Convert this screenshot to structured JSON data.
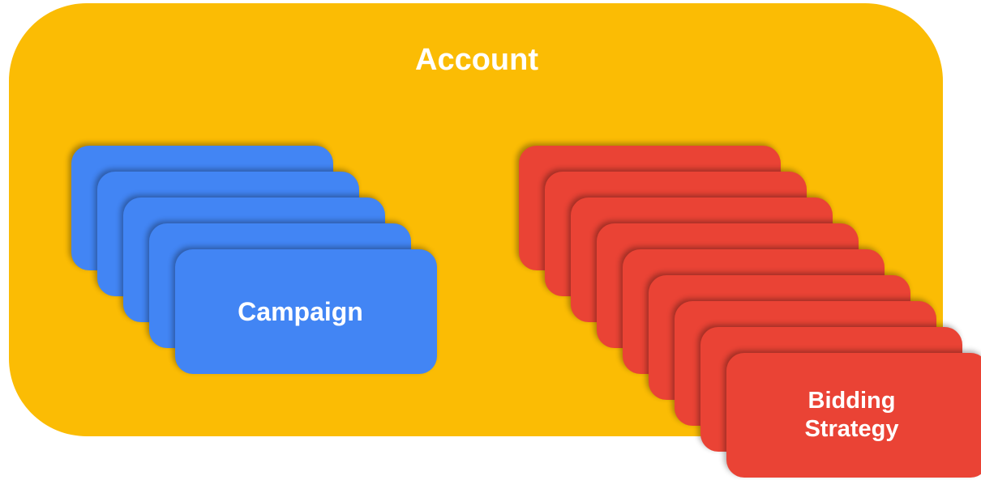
{
  "account": {
    "label": "Account",
    "color": "#FBBC04"
  },
  "campaign": {
    "label": "Campaign",
    "color": "#4285F4",
    "stack_count": 5
  },
  "bidding_strategy": {
    "label": "Bidding\nStrategy",
    "color": "#EA4335",
    "stack_count": 9
  }
}
